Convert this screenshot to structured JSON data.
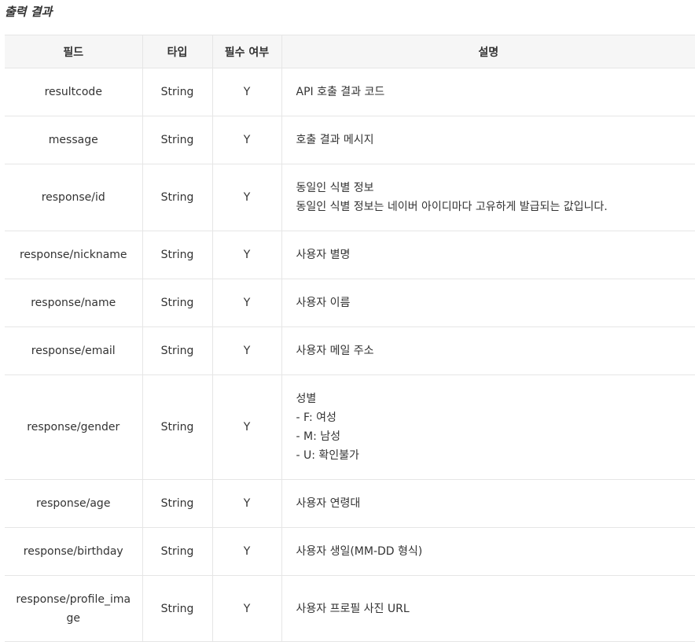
{
  "section": {
    "title": "출력 결과"
  },
  "table": {
    "headers": [
      "필드",
      "타입",
      "필수 여부",
      "설명"
    ],
    "rows": [
      {
        "field": "resultcode",
        "type": "String",
        "required": "Y",
        "description": [
          "API 호출 결과 코드"
        ]
      },
      {
        "field": "message",
        "type": "String",
        "required": "Y",
        "description": [
          "호출 결과 메시지"
        ]
      },
      {
        "field": "response/id",
        "type": "String",
        "required": "Y",
        "description": [
          "동일인 식별 정보",
          "동일인 식별 정보는 네이버 아이디마다 고유하게 발급되는 값입니다."
        ]
      },
      {
        "field": "response/nickname",
        "type": "String",
        "required": "Y",
        "description": [
          "사용자 별명"
        ]
      },
      {
        "field": "response/name",
        "type": "String",
        "required": "Y",
        "description": [
          "사용자 이름"
        ]
      },
      {
        "field": "response/email",
        "type": "String",
        "required": "Y",
        "description": [
          "사용자 메일 주소"
        ]
      },
      {
        "field": "response/gender",
        "type": "String",
        "required": "Y",
        "description": [
          "성별",
          "- F: 여성",
          "- M: 남성",
          "- U: 확인불가"
        ]
      },
      {
        "field": "response/age",
        "type": "String",
        "required": "Y",
        "description": [
          "사용자 연령대"
        ]
      },
      {
        "field": "response/birthday",
        "type": "String",
        "required": "Y",
        "description": [
          "사용자 생일(MM-DD 형식)"
        ]
      },
      {
        "field": "response/profile_image",
        "type": "String",
        "required": "Y",
        "description": [
          "사용자 프로필 사진 URL"
        ]
      }
    ]
  }
}
